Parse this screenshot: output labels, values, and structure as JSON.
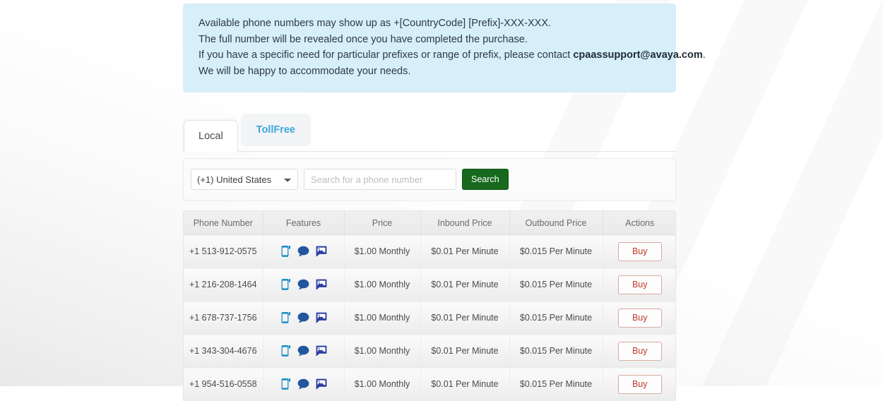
{
  "info_banner": {
    "lines": [
      "Available phone numbers may show up as +[CountryCode] [Prefix]-XXX-XXX.",
      "The full number will be revealed once you have completed the purchase.",
      "We will be happy to accommodate your needs."
    ],
    "contact_line_prefix": "If you have a specific need for particular prefixes or range of prefix, please contact ",
    "contact_email": "cpaassupport@avaya.com",
    "contact_line_suffix": ".",
    "background_color": "#d6eff8"
  },
  "tabs": [
    {
      "label": "Local",
      "active": true
    },
    {
      "label": "TollFree",
      "active": false
    }
  ],
  "search": {
    "country": "(+1) United States",
    "country_options": [
      "(+1) United States"
    ],
    "placeholder": "Search for a phone number",
    "value": "",
    "button_label": "Search",
    "button_color": "#17691d"
  },
  "table": {
    "columns": [
      "Phone Number",
      "Features",
      "Price",
      "Inbound Price",
      "Outbound Price",
      "Actions"
    ],
    "feature_icons": [
      "voice-phone-icon",
      "sms-chat-icon",
      "mms-image-icon"
    ],
    "action_label": "Buy",
    "rows": [
      {
        "phone": "+1 513-912-0575",
        "features": [
          "voice",
          "sms",
          "mms"
        ],
        "price": "$1.00 Monthly",
        "inbound": "$0.01 Per Minute",
        "outbound": "$0.015 Per Minute",
        "action": "Buy"
      },
      {
        "phone": "+1 216-208-1464",
        "features": [
          "voice",
          "sms",
          "mms"
        ],
        "price": "$1.00 Monthly",
        "inbound": "$0.01 Per Minute",
        "outbound": "$0.015 Per Minute",
        "action": "Buy"
      },
      {
        "phone": "+1 678-737-1756",
        "features": [
          "voice",
          "sms",
          "mms"
        ],
        "price": "$1.00 Monthly",
        "inbound": "$0.01 Per Minute",
        "outbound": "$0.015 Per Minute",
        "action": "Buy"
      },
      {
        "phone": "+1 343-304-4676",
        "features": [
          "voice",
          "sms",
          "mms"
        ],
        "price": "$1.00 Monthly",
        "inbound": "$0.01 Per Minute",
        "outbound": "$0.015 Per Minute",
        "action": "Buy"
      },
      {
        "phone": "+1 954-516-0558",
        "features": [
          "voice",
          "sms",
          "mms"
        ],
        "price": "$1.00 Monthly",
        "inbound": "$0.01 Per Minute",
        "outbound": "$0.015 Per Minute",
        "action": "Buy"
      }
    ]
  },
  "colors": {
    "tab_active_text": "#4a4a4a",
    "tab_inactive_text": "#3aa7dd",
    "buy_text": "#c0392b",
    "buy_border": "#dba9a2",
    "icon_voice": "#1b8ec4",
    "icon_sms": "#22569e",
    "icon_mms": "#2b3f9e"
  }
}
